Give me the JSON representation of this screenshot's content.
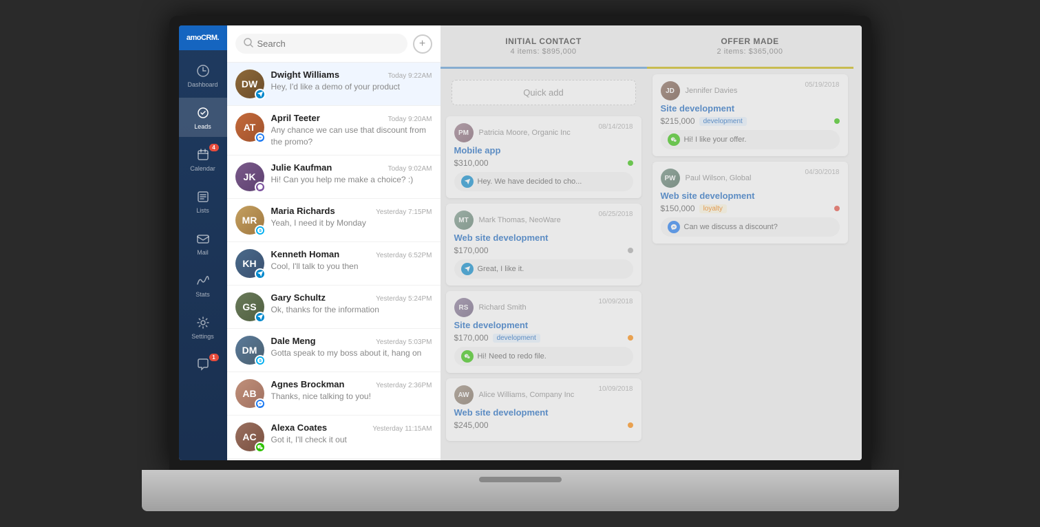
{
  "app": {
    "logo": "amoCRM.",
    "title": "amoCRM"
  },
  "sidebar": {
    "items": [
      {
        "id": "dashboard",
        "label": "Dashboard",
        "icon": "⊙",
        "badge": null
      },
      {
        "id": "leads",
        "label": "Leads",
        "icon": "S",
        "badge": null,
        "active": true
      },
      {
        "id": "calendar",
        "label": "Calendar",
        "icon": "✓",
        "badge": "4"
      },
      {
        "id": "lists",
        "label": "Lists",
        "icon": "≡",
        "badge": null
      },
      {
        "id": "mail",
        "label": "Mail",
        "icon": "✉",
        "badge": null
      },
      {
        "id": "stats",
        "label": "Stats",
        "icon": "∿",
        "badge": null
      },
      {
        "id": "settings",
        "label": "Settings",
        "icon": "⚙",
        "badge": null
      },
      {
        "id": "chat",
        "label": "Chat",
        "icon": "💬",
        "badge": "1"
      }
    ]
  },
  "search": {
    "placeholder": "Search"
  },
  "chats": [
    {
      "id": 1,
      "name": "Dwight Williams",
      "time": "Today 9:22AM",
      "preview": "Hey, I'd like a demo of your product",
      "messenger": "telegram",
      "active": true,
      "initials": "DW",
      "color": "av-dw"
    },
    {
      "id": 2,
      "name": "April Teeter",
      "time": "Today 9:20AM",
      "preview": "Any chance we can use that discount from the promo?",
      "messenger": "messenger",
      "active": false,
      "initials": "AT",
      "color": "av-at"
    },
    {
      "id": 3,
      "name": "Julie Kaufman",
      "time": "Today 9:02AM",
      "preview": "Hi! Can you help me make a choice? :)",
      "messenger": "viber",
      "active": false,
      "initials": "JK",
      "color": "av-jk"
    },
    {
      "id": 4,
      "name": "Maria Richards",
      "time": "Yesterday 7:15PM",
      "preview": "Yeah, I need it by Monday",
      "messenger": "skype",
      "active": false,
      "initials": "MR",
      "color": "av-mr"
    },
    {
      "id": 5,
      "name": "Kenneth Homan",
      "time": "Yesterday 6:52PM",
      "preview": "Cool, I'll talk to you then",
      "messenger": "telegram",
      "active": false,
      "initials": "KH",
      "color": "av-kh"
    },
    {
      "id": 6,
      "name": "Gary Schultz",
      "time": "Yesterday 5:24PM",
      "preview": "Ok, thanks for the information",
      "messenger": "telegram",
      "active": false,
      "initials": "GS",
      "color": "av-gs"
    },
    {
      "id": 7,
      "name": "Dale Meng",
      "time": "Yesterday 5:03PM",
      "preview": "Gotta speak to my boss about it, hang on",
      "messenger": "skype",
      "active": false,
      "initials": "DM",
      "color": "av-dm"
    },
    {
      "id": 8,
      "name": "Agnes Brockman",
      "time": "Yesterday 2:36PM",
      "preview": "Thanks, nice talking to you!",
      "messenger": "messenger",
      "active": false,
      "initials": "AB",
      "color": "av-ab"
    },
    {
      "id": 9,
      "name": "Alexa Coates",
      "time": "Yesterday 11:15AM",
      "preview": "Got it, I'll check it out",
      "messenger": "wechat",
      "active": false,
      "initials": "AC",
      "color": "av-ac"
    }
  ],
  "pipeline": {
    "columns": [
      {
        "id": "initial_contact",
        "title": "INITIAL CONTACT",
        "subtitle": "4 items: $895,000",
        "color_class": "initial",
        "quick_add": "Quick add",
        "cards": [
          {
            "contact": "Patricia Moore, Organic Inc",
            "date": "08/14/2018",
            "deal": "Mobile app",
            "amount": "$310,000",
            "tag": null,
            "dot_color": "#2dc100",
            "message": "Hey. We have decided to cho...",
            "msg_type": "telegram",
            "initials": "PM",
            "color": "av-pm"
          },
          {
            "contact": "Mark Thomas, NeoWare",
            "date": "06/25/2018",
            "deal": "Web site development",
            "amount": "$170,000",
            "tag": null,
            "dot_color": "#aaa",
            "message": "Great, I like it.",
            "msg_type": "telegram",
            "initials": "MT",
            "color": "av-mt"
          },
          {
            "contact": "Richard Smith",
            "date": "10/09/2018",
            "deal": "Site development",
            "amount": "$170,000",
            "tag": "development",
            "tag_type": "",
            "dot_color": "#ff8800",
            "message": "Hi! Need to redo file.",
            "msg_type": "wechat",
            "initials": "RS",
            "color": "av-rs"
          },
          {
            "contact": "Alice Williams, Company Inc",
            "date": "10/09/2018",
            "deal": "Web site development",
            "amount": "$245,000",
            "tag": null,
            "dot_color": "#ff8800",
            "message": null,
            "initials": "AW",
            "color": "av-aw"
          }
        ]
      },
      {
        "id": "offer_made",
        "title": "OFFER MADE",
        "subtitle": "2 items: $365,000",
        "color_class": "offer",
        "cards": [
          {
            "contact": "Jennifer Davies",
            "date": "05/19/2018",
            "deal": "Site development",
            "amount": "$215,000",
            "tag": "development",
            "tag_type": "",
            "dot_color": "#2dc100",
            "message": "Hi! I like your offer.",
            "msg_type": "wechat",
            "initials": "JD",
            "color": "av-jd"
          },
          {
            "contact": "Paul Wilson, Global",
            "date": "04/30/2018",
            "deal": "Web site development",
            "amount": "$150,000",
            "tag": "loyalty",
            "tag_type": "loyalty",
            "dot_color": "#e74c3c",
            "message": "Can we discuss a discount?",
            "msg_type": "messenger",
            "initials": "PW",
            "color": "av-pw"
          }
        ]
      }
    ]
  },
  "icons": {
    "search": "🔍",
    "add": "+",
    "telegram": "✈",
    "messenger": "⚡",
    "viber": "📞",
    "skype": "S",
    "wechat": "💬"
  }
}
